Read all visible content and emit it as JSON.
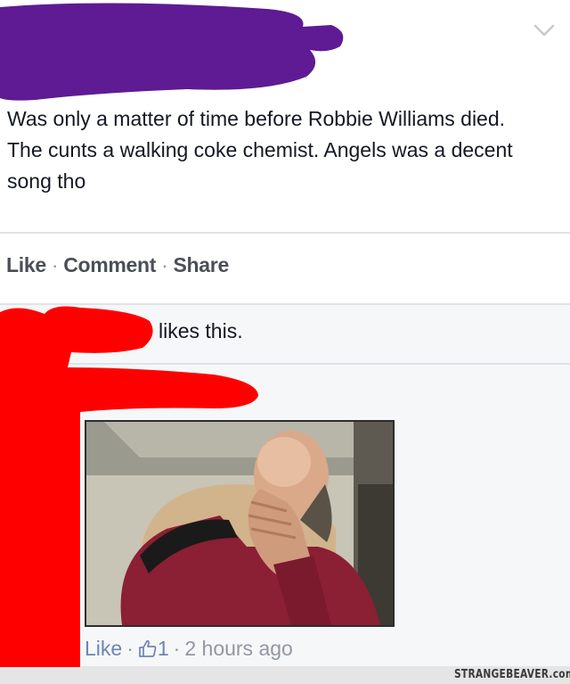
{
  "post": {
    "text": "Was only a matter of time before Robbie Williams died. The cunts a walking coke chemist. Angels was a decent song tho",
    "menu_icon": "chevron-down-icon"
  },
  "actions": {
    "like": "Like",
    "comment": "Comment",
    "share": "Share",
    "separator": "·"
  },
  "likes": {
    "text": "likes this."
  },
  "comment": {
    "photo": "picard-facepalm-image",
    "like_label": "Like",
    "separator": "·",
    "like_icon": "thumbs-up-icon",
    "like_count": "1",
    "time": "2 hours ago"
  },
  "watermark": {
    "text": "STRANGEBEAVER.com"
  },
  "colors": {
    "purple_redaction": "#5e1b93",
    "red_redaction": "#ff0000",
    "link_blue": "#6d84b4",
    "muted_gray": "#9197a3"
  }
}
